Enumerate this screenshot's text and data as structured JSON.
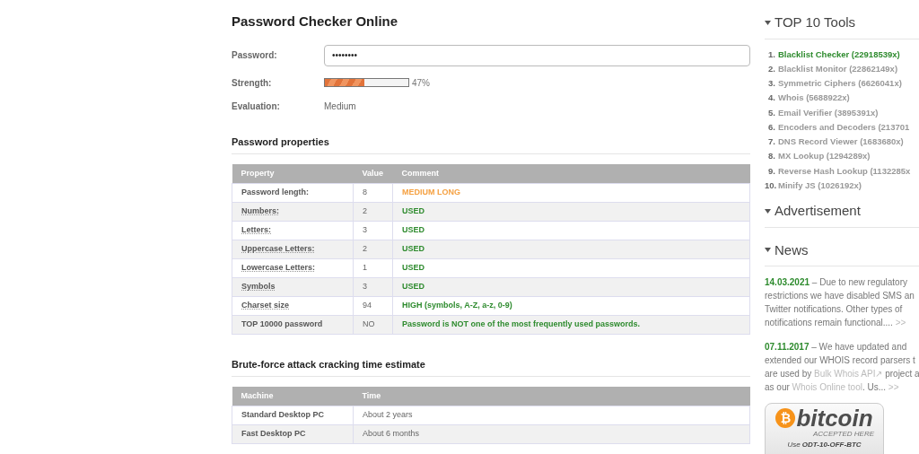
{
  "title": "Password Checker Online",
  "form": {
    "password_label": "Password:",
    "password_value": "••••••••",
    "strength_label": "Strength:",
    "strength": {
      "level": 0.47,
      "reading": "47%"
    },
    "evaluation_label": "Evaluation:",
    "evaluation": "Medium"
  },
  "properties": {
    "heading": "Password properties",
    "columns": [
      "Property",
      "Value",
      "Comment"
    ],
    "rows": [
      {
        "property": "Password length:",
        "hint": false,
        "value": "8",
        "comment": "MEDIUM LONG",
        "color": "#f5a142"
      },
      {
        "property": "Numbers:",
        "hint": true,
        "value": "2",
        "comment": "USED",
        "color": "#2e8b2e"
      },
      {
        "property": "Letters:",
        "hint": true,
        "value": "3",
        "comment": "USED",
        "color": "#2e8b2e"
      },
      {
        "property": "Uppercase Letters:",
        "hint": true,
        "value": "2",
        "comment": "USED",
        "color": "#2e8b2e"
      },
      {
        "property": "Lowercase Letters:",
        "hint": true,
        "value": "1",
        "comment": "USED",
        "color": "#2e8b2e"
      },
      {
        "property": "Symbols",
        "hint": true,
        "value": "3",
        "comment": "USED",
        "color": "#2e8b2e"
      },
      {
        "property": "Charset size",
        "hint": true,
        "value": "94",
        "comment": "HIGH (symbols, A-Z, a-z, 0-9)",
        "color": "#2e8b2e"
      },
      {
        "property": "TOP 10000 password",
        "hint": false,
        "value": "NO",
        "comment": "Password is NOT one of the most frequently used passwords.",
        "color": "#2e8b2e"
      }
    ]
  },
  "bruteforce": {
    "heading": "Brute-force attack cracking time estimate",
    "columns": [
      "Machine",
      "Time"
    ],
    "rows": [
      {
        "machine": "Standard Desktop PC",
        "time": "About 2 years"
      },
      {
        "machine": "Fast Desktop PC",
        "time": "About 6 months"
      }
    ]
  },
  "sidebar": {
    "top_tools": {
      "heading": "TOP 10 Tools",
      "items": [
        {
          "number": "1.",
          "label": "Blacklist Checker (22918539x)",
          "selected": true
        },
        {
          "number": "2.",
          "label": "Blacklist Monitor (22862149x)",
          "selected": false
        },
        {
          "number": "3.",
          "label": "Symmetric Ciphers (6626041x)",
          "selected": false
        },
        {
          "number": "4.",
          "label": "Whois (5688922x)",
          "selected": false
        },
        {
          "number": "5.",
          "label": "Email Verifier (3895391x)",
          "selected": false
        },
        {
          "number": "6.",
          "label": "Encoders and Decoders (213701",
          "selected": false
        },
        {
          "number": "7.",
          "label": "DNS Record Viewer (1683680x)",
          "selected": false
        },
        {
          "number": "8.",
          "label": "MX Lookup (1294289x)",
          "selected": false
        },
        {
          "number": "9.",
          "label": "Reverse Hash Lookup (1132285x",
          "selected": false
        },
        {
          "number": "10.",
          "label": "Minify JS (1026192x)",
          "selected": false
        }
      ]
    },
    "advertisement": {
      "heading": "Advertisement"
    },
    "news": {
      "heading": "News",
      "items": [
        {
          "date": "14.03.2021",
          "lines": [
            [
              {
                "text": " – Due to new regulatory",
                "link": false
              }
            ],
            [
              {
                "text": "restrictions we have disabled SMS an",
                "link": false
              }
            ],
            [
              {
                "text": "Twitter notifications. Other types of",
                "link": false
              }
            ],
            [
              {
                "text": "notifications remain functional.... ",
                "link": false
              },
              {
                "text": ">>",
                "link": true
              }
            ]
          ]
        },
        {
          "date": "07.11.2017",
          "lines": [
            [
              {
                "text": " – We have updated and",
                "link": false
              }
            ],
            [
              {
                "text": "extended our WHOIS record parsers t",
                "link": false
              }
            ],
            [
              {
                "text": "are used by ",
                "link": false
              },
              {
                "text": "Bulk Whois API↗",
                "link": true
              },
              {
                "text": " project a",
                "link": false
              }
            ],
            [
              {
                "text": "as our ",
                "link": false
              },
              {
                "text": "Whois Online tool",
                "link": true
              },
              {
                "text": ". Us... ",
                "link": false
              },
              {
                "text": ">>",
                "link": true
              }
            ]
          ]
        }
      ]
    },
    "bitcoin_ad": {
      "symbol": "₿",
      "wordmark": "bitcoin",
      "tagline": "ACCEPTED HERE",
      "promo": "Use **ODT-10-OFF-BTC**"
    }
  }
}
